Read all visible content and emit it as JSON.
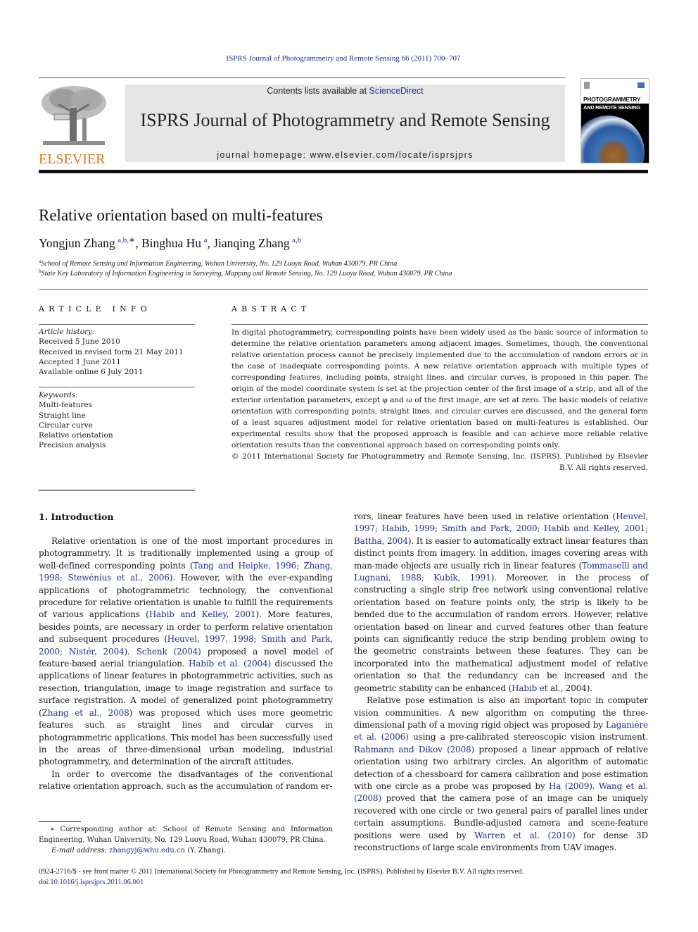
{
  "running_head": "ISPRS Journal of Photogrammetry and Remote Sensing 66 (2011) 700–707",
  "publisher": {
    "logo_text": "ELSEVIER",
    "logo_color": "#e9711c"
  },
  "banner": {
    "contents_prefix": "Contents lists available at ",
    "contents_link": "ScienceDirect",
    "journal_title": "ISPRS Journal of Photogrammetry and Remote Sensing",
    "homepage": "journal homepage: www.elsevier.com/locate/isprsjprs"
  },
  "cover": {
    "line1": "PHOTOGRAMMETRY",
    "line2": "AND REMOTE SENSING"
  },
  "article": {
    "title": "Relative orientation based on multi-features",
    "authors": [
      {
        "name": "Yongjun Zhang",
        "sup": "a,b,∗"
      },
      {
        "name": "Binghua Hu",
        "sup": "a"
      },
      {
        "name": "Jianqing Zhang",
        "sup": "a,b"
      }
    ],
    "affiliations": [
      {
        "key": "a",
        "text": "School of Remote Sensing and Information Engineering, Wuhan University, No. 129 Luoyu Road, Wuhan 430079, PR China"
      },
      {
        "key": "b",
        "text": "State Key Laboratory of Information Engineering in Surveying, Mapping and Remote Sensing, No. 129 Luoyu Road, Wuhan 430079, PR China"
      }
    ]
  },
  "article_info": {
    "heading": "ARTICLE INFO",
    "history_label": "Article history:",
    "history": [
      "Received 5 June 2010",
      "Received in revised form 21 May 2011",
      "Accepted 1 June 2011",
      "Available online 6 July 2011"
    ],
    "keywords_label": "Keywords:",
    "keywords": [
      "Multi-features",
      "Straight line",
      "Circular curve",
      "Relative orientation",
      "Precision analysis"
    ]
  },
  "abstract": {
    "heading": "ABSTRACT",
    "text": "In digital photogrammetry, corresponding points have been widely used as the basic source of information to determine the relative orientation parameters among adjacent images. Sometimes, though, the conventional relative orientation process cannot be precisely implemented due to the accumulation of random errors or in the case of inadequate corresponding points. A new relative orientation approach with multiple types of corresponding features, including points, straight lines, and circular curves, is proposed in this paper. The origin of the model coordinate system is set at the projection center of the first image of a strip, and all of the exterior orientation parameters, except φ and ω of the first image, are set at zero. The basic models of relative orientation with corresponding points, straight lines, and circular curves are discussed, and the general form of a least squares adjustment model for relative orientation based on multi-features is established. Our experimental results show that the proposed approach is feasible and can achieve more reliable relative orientation results than the conventional approach based on corresponding points only.",
    "copyright": "© 2011 International Society for Photogrammetry and Remote Sensing, Inc. (ISPRS). Published by Elsevier B.V. All rights reserved."
  },
  "intro": {
    "heading": "1. Introduction",
    "left_p1": [
      {
        "t": "Relative orientation is one of the most important procedures in photogrammetry. It is traditionally implemented using a group of well-defined corresponding points ("
      },
      {
        "l": "Tang and Heipke, 1996; Zhang, 1998; Stewénius et al., 2006"
      },
      {
        "t": "). However, with the ever-expanding applications of photogrammetric technology, the conventional procedure for relative orientation is unable to fulfill the requirements of various applications ("
      },
      {
        "l": "Habib and Kelley, 2001"
      },
      {
        "t": "). More features, besides points, are necessary in order to perform relative orientation and subsequent procedures ("
      },
      {
        "l": "Heuvel, 1997, 1998; Smith and Park, 2000; Nistér, 2004"
      },
      {
        "t": "). "
      },
      {
        "l": "Schenk (2004)"
      },
      {
        "t": " proposed a novel model of feature-based aerial triangulation. "
      },
      {
        "l": "Habib et al. (2004)"
      },
      {
        "t": " discussed the applications of linear features in photogrammetric activities, such as resection, triangulation, image to image registration and surface to surface registration. A model of generalized point photogrammetry ("
      },
      {
        "l": "Zhang et al., 2008"
      },
      {
        "t": ") was proposed which uses more geometric features such as straight lines and circular curves in photogrammetric applications. This model has been successfully used in the areas of three-dimensional urban modeling, industrial photogrammetry, and determination of the aircraft attitudes."
      }
    ],
    "left_p2": [
      {
        "t": "In order to overcome the disadvantages of the conventional relative orientation approach, such as the accumulation of random er-"
      }
    ],
    "right_p1": [
      {
        "t": "rors, linear features have been used in relative orientation ("
      },
      {
        "l": "Heuvel, 1997; Habib, 1999; Smith and Park, 2000; Habib and Kelley, 2001; Battha, 2004"
      },
      {
        "t": "). It is easier to automatically extract linear features than distinct points from imagery. In addition, images covering areas with man-made objects are usually rich in linear features ("
      },
      {
        "l": "Tommaselli and Lugnani, 1988; Kubik, 1991"
      },
      {
        "t": "). Moreover, in the process of constructing a single strip free network using conventional relative orientation based on feature points only, the strip is likely to be bended due to the accumulation of random errors. However, relative orientation based on linear and curved features other than feature points can significantly reduce the strip bending problem owing to the geometric constraints between these features. They can be incorporated into the mathematical adjustment model of relative orientation so that the redundancy can be increased and the geometric stability can be enhanced ("
      },
      {
        "l": "Habib et"
      },
      {
        "t": " al., 2004)."
      }
    ],
    "right_p2": [
      {
        "t": "Relative pose estimation is also an important topic in computer vision communities. A new algorithm on computing the three-dimensional path of a moving rigid object was proposed by "
      },
      {
        "l": "Laganière et al. (2006)"
      },
      {
        "t": " using a pre-calibrated stereoscopic vision instrument. "
      },
      {
        "l": "Rahmann and Dikov (2008)"
      },
      {
        "t": " proposed a linear approach of relative orientation using two arbitrary circles. An algorithm of automatic detection of a chessboard for camera calibration and pose estimation with one circle as a probe was proposed by "
      },
      {
        "l": "Ha (2009)"
      },
      {
        "t": ". "
      },
      {
        "l": "Wang et al. (2008)"
      },
      {
        "t": " proved that the camera pose of an image can be uniquely recovered with one circle or two general pairs of parallel lines under certain assumptions. Bundle-adjusted camera and scene-feature positions were used by "
      },
      {
        "l": "Warren et al. (2010)"
      },
      {
        "t": " for dense 3D reconstructions of large scale environments from UAV images."
      }
    ]
  },
  "footnote": {
    "marker": "∗",
    "text": "Corresponding author at: School of Remote Sensing and Information Engineering, Wuhan University, No. 129 Luoyu Road, Wuhan 430079, PR China.",
    "email_label": "E-mail address: ",
    "email": "zhangyj@whu.edu.cn",
    "email_suffix": " (Y. Zhang)."
  },
  "bottom": {
    "issn_line": "0924-2716/$ - see front matter © 2011 International Society for Photogrammetry and Remote Sensing, Inc. (ISPRS). Published by Elsevier B.V. All rights reserved.",
    "doi_prefix": "doi:",
    "doi": "10.1016/j.isprsjprs.2011.06.001"
  },
  "colors": {
    "link": "#1f2f8c",
    "banner_bg": "#e6e6e6",
    "elsevier_orange": "#e9711c"
  }
}
